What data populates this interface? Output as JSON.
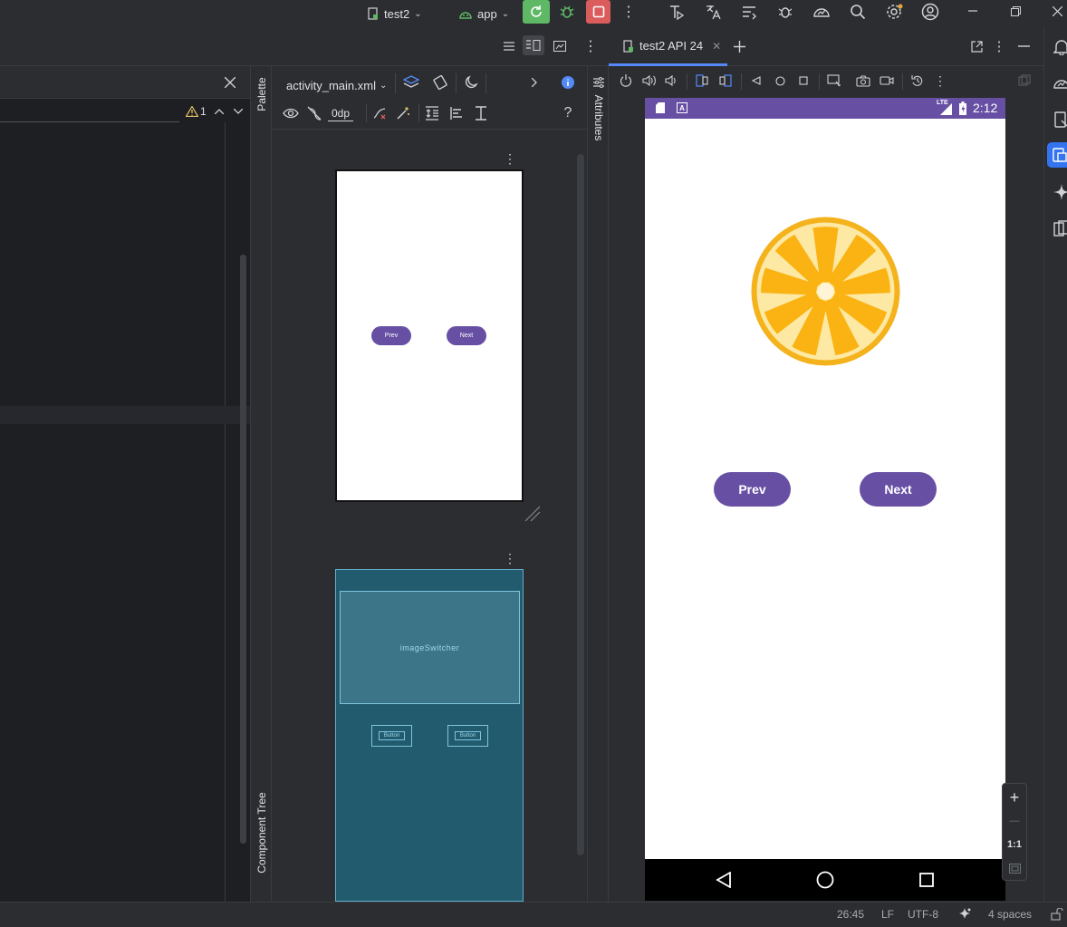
{
  "titlebar": {
    "project": "test2",
    "run_config": "app",
    "colors": {
      "run_green": "#5fb865",
      "stop_red": "#db5c5c",
      "bug_green": "#5fb865"
    }
  },
  "left_panel": {
    "warning_count": "1"
  },
  "side_tabs": {
    "palette": "Palette",
    "component_tree": "Component Tree",
    "attributes": "Attributes"
  },
  "designer": {
    "file_name": "activity_main.xml",
    "margin_value": "0dp",
    "help": "?",
    "design_preview": {
      "prev_label": "Prev",
      "next_label": "Next"
    },
    "blueprint": {
      "image_switcher_label": "imageSwitcher",
      "button1_label": "Button",
      "button2_label": "Button"
    }
  },
  "emulator": {
    "tab_title": "test2 API 24",
    "status_time": "2:12",
    "status_lte": "LTE",
    "app": {
      "prev_label": "Prev",
      "next_label": "Next",
      "accent": "#6750a4"
    },
    "zoom": {
      "plus": "+",
      "minus": "—",
      "ratio": "1:1"
    }
  },
  "statusbar": {
    "position": "26:45",
    "line_ending": "LF",
    "encoding": "UTF-8",
    "indent": "4 spaces"
  }
}
